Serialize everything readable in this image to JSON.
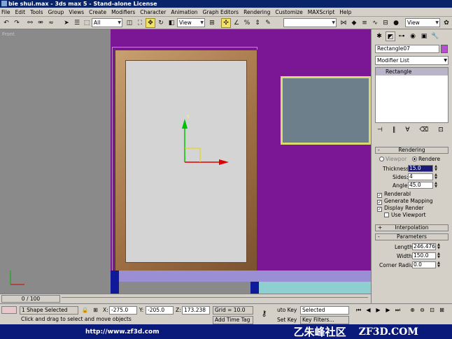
{
  "window": {
    "title": "bie shui.max - 3ds max 5 - Stand-alone License"
  },
  "menu": [
    "File",
    "Edit",
    "Tools",
    "Group",
    "Views",
    "Create",
    "Modifiers",
    "Character",
    "Animation",
    "Graph Editors",
    "Rendering",
    "Customize",
    "MAXScript",
    "Help"
  ],
  "toolbar": {
    "selection_filter": "All",
    "ref_coord": "View",
    "named_selection": "",
    "view_right": "View"
  },
  "viewport": {
    "label": "Front"
  },
  "command_panel": {
    "object_name": "Rectangle07",
    "modifier_list": "Modifier List",
    "stack_item": "Rectangle",
    "rendering": {
      "title": "Rendering",
      "viewport_label": "Viewpor",
      "renderer_label": "Rendere",
      "thickness_label": "Thickness:",
      "thickness_value": "15.0",
      "sides_label": "Sides:",
      "sides_value": "4",
      "angle_label": "Angle:",
      "angle_value": "45.0",
      "renderable": "Renderabl",
      "generate_mapping": "Generate Mapping",
      "display_render": "Display Render",
      "use_viewport": "Use Viewport"
    },
    "interpolation_title": "Interpolation",
    "parameters": {
      "title": "Parameters",
      "length_label": "Length:",
      "length_value": "246.476",
      "width_label": "Width:",
      "width_value": "150.0",
      "corner_label": "Corner Radius:",
      "corner_value": "0.0"
    }
  },
  "timebar": {
    "slider": "0 / 100"
  },
  "status": {
    "selection": "1 Shape Selected",
    "x_label": "X:",
    "x_value": "-275.0",
    "y_label": "Y:",
    "y_value": "-205.0",
    "z_label": "Z:",
    "z_value": "173.238",
    "grid": "Grid = 10.0",
    "auto_key": "uto Key",
    "set_key": "Set Key",
    "selected_dd": "Selected",
    "key_filters": "Key Filters...",
    "prompt": "Click and drag to select and move objects",
    "add_time_tag": "Add Time Tag"
  },
  "footer": {
    "url": "http://www.zf3d.com",
    "logo": "乙朱峰社区",
    "brand": "ZF3D.COM"
  },
  "colors": {
    "viewport_bg": "#7b1794",
    "frame": "#a17145",
    "accent": "#f2e26a"
  }
}
